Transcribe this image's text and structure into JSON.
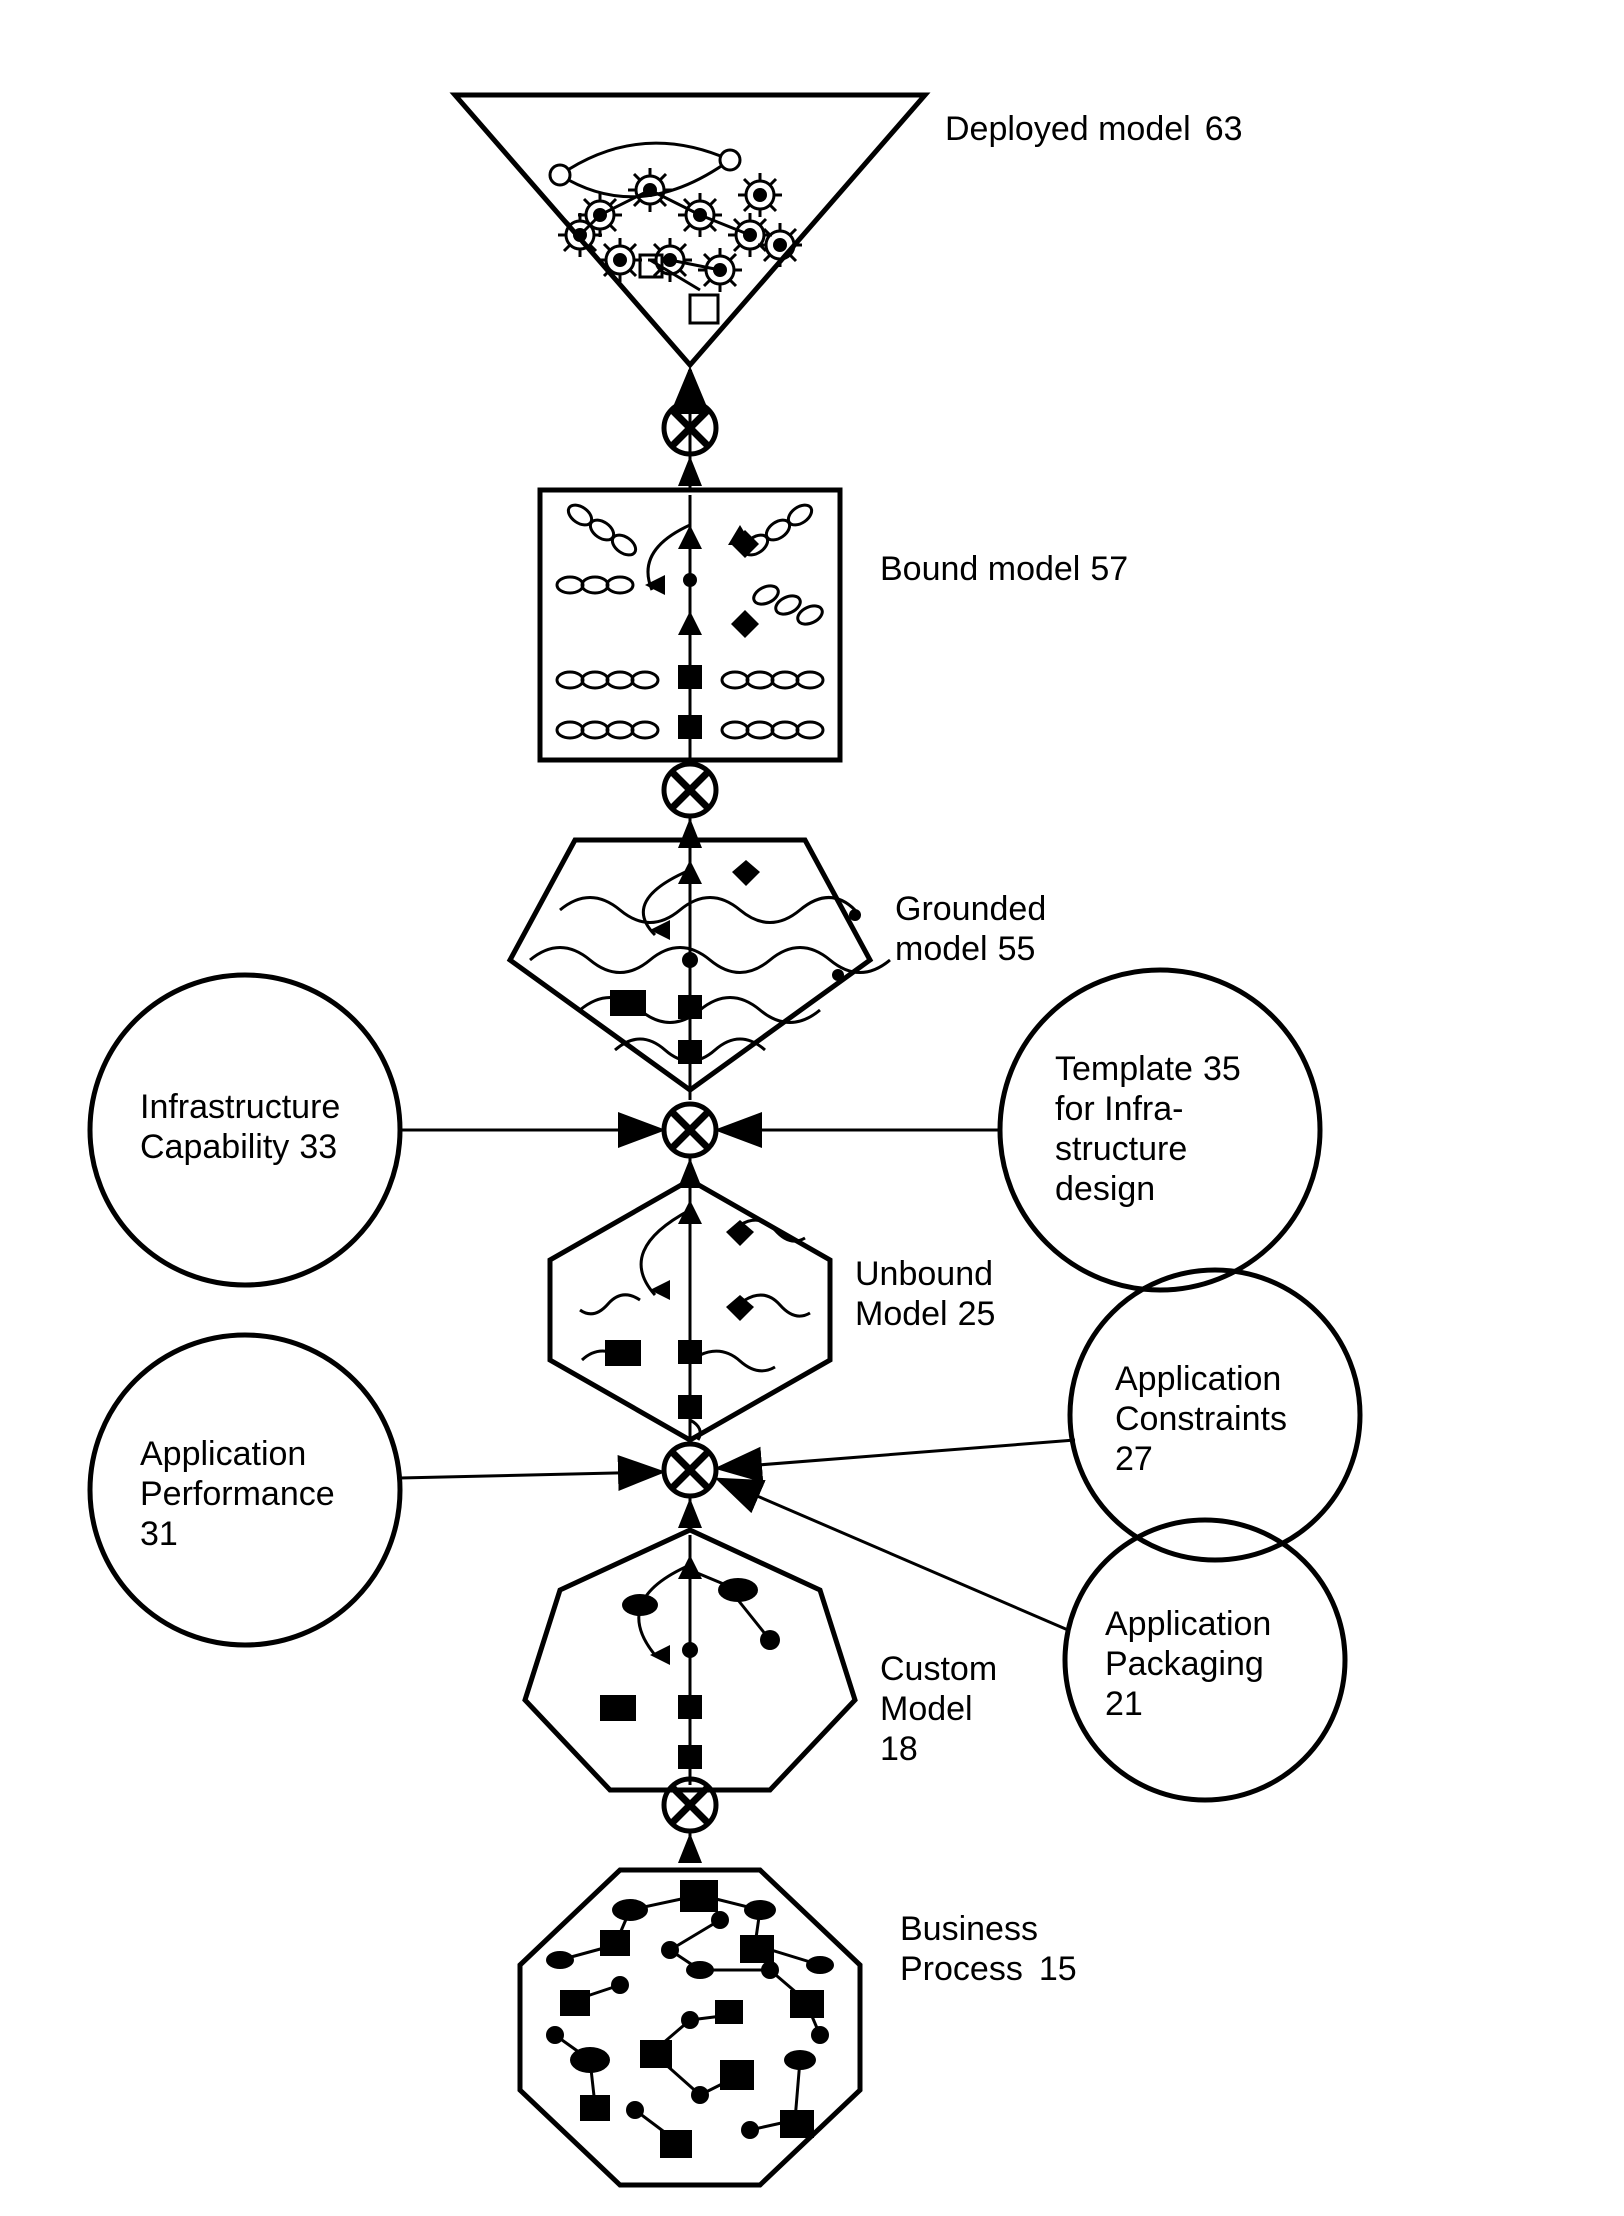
{
  "stages": {
    "deployed": {
      "label": "Deployed model",
      "ref": "63"
    },
    "bound": {
      "label": "Bound model",
      "ref": "57"
    },
    "grounded": {
      "label_line1": "Grounded",
      "label_line2": "model",
      "ref": "55"
    },
    "unbound": {
      "label_line1": "Unbound",
      "label_line2": "Model",
      "ref": "25"
    },
    "custom": {
      "label_line1": "Custom",
      "label_line2": "Model",
      "ref": "18"
    },
    "business": {
      "label_line1": "Business",
      "label_line2": "Process",
      "ref": "15"
    }
  },
  "inputs": {
    "infra_cap": {
      "label_line1": "Infrastructure",
      "label_line2": "Capability",
      "ref": "33"
    },
    "template": {
      "label_line1": "Template",
      "ref_line": "35",
      "line2": "for Infra-",
      "line3": "structure",
      "line4": "design"
    },
    "app_perf": {
      "label_line1": "Application",
      "label_line2": "Performance",
      "ref": "31"
    },
    "app_constraints": {
      "label_line1": "Application",
      "label_line2": "Constraints",
      "ref": "27"
    },
    "app_packaging": {
      "label_line1": "Application",
      "label_line2": "Packaging",
      "ref": "21"
    }
  }
}
